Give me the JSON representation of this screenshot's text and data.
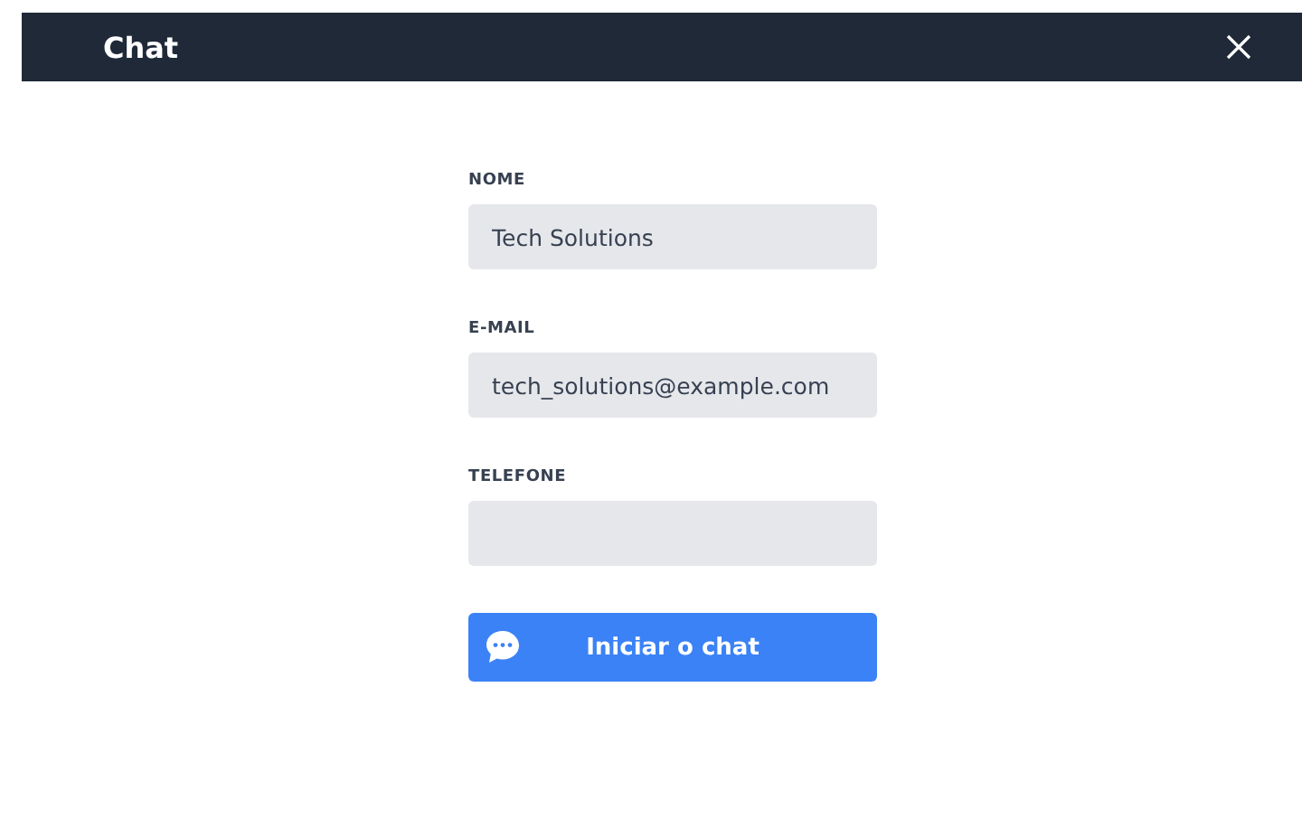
{
  "window": {
    "title": "Chat"
  },
  "fields": [
    {
      "label": "NOME",
      "value": "Tech Solutions"
    },
    {
      "label": "E-MAIL",
      "value": "tech_solutions@example.com"
    },
    {
      "label": "TELEFONE"
    }
  ],
  "submit": {
    "label": "Iniciar o chat"
  }
}
